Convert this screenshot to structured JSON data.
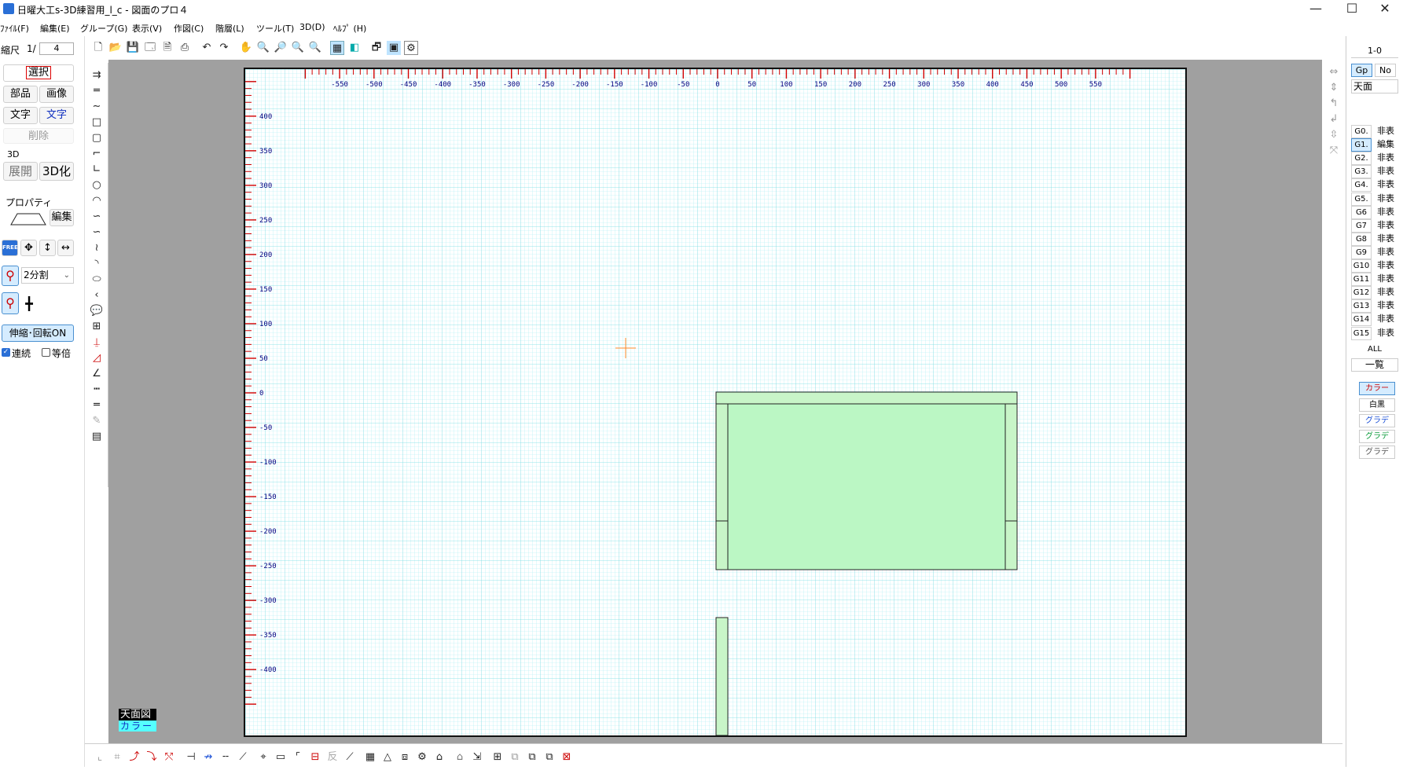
{
  "window": {
    "title": "日曜大工s-3D練習用_l_c - 図面のプロ４",
    "minimize": "—",
    "maximize": "☐",
    "close": "✕"
  },
  "menu": [
    "ﾌｧｲﾙ(F)",
    "編集(E)",
    "グループ(G)",
    "表示(V)",
    "作図(C)",
    "階層(L)",
    "ツール(T)",
    "3D(D)",
    "ﾍﾙﾌﾟ (H)"
  ],
  "left": {
    "scale_label": "縮尺",
    "scale_prefix": "1/",
    "scale_value": "4",
    "select": "選択",
    "parts": "部品",
    "image": "画像",
    "text": "文字",
    "text2": "文字",
    "delete": "削除",
    "section_3d": "3D",
    "expand": "展開",
    "to3d": "3D化",
    "property": "プロパティ",
    "edit": "編集",
    "free": "FREE",
    "split_value": "2分割",
    "scale_rotate": "伸縮･回転ON",
    "continuous": "連続",
    "equal": "等倍"
  },
  "canvas": {
    "x_ticks": [
      "-550",
      "-500",
      "-450",
      "-400",
      "-350",
      "-300",
      "-250",
      "-200",
      "-150",
      "-100",
      "-50",
      "0",
      "50",
      "100",
      "150",
      "200",
      "250",
      "300",
      "350",
      "400",
      "450",
      "500",
      "550"
    ],
    "y_ticks": [
      "400",
      "350",
      "300",
      "250",
      "200",
      "150",
      "100",
      "50",
      "0",
      "-50",
      "-100",
      "-150",
      "-200",
      "-250",
      "-300",
      "-350",
      "-400"
    ],
    "view_name": "天面図",
    "view_mode": "カラー"
  },
  "right": {
    "layer_id": "1-0",
    "gp": "Gp",
    "no": "No",
    "view": "天面",
    "groups": [
      {
        "g": "G0.",
        "s": "非表"
      },
      {
        "g": "G1.",
        "s": "編集"
      },
      {
        "g": "G2.",
        "s": "非表"
      },
      {
        "g": "G3.",
        "s": "非表"
      },
      {
        "g": "G4.",
        "s": "非表"
      },
      {
        "g": "G5.",
        "s": "非表"
      },
      {
        "g": "G6",
        "s": "非表"
      },
      {
        "g": "G7",
        "s": "非表"
      },
      {
        "g": "G8",
        "s": "非表"
      },
      {
        "g": "G9",
        "s": "非表"
      },
      {
        "g": "G10",
        "s": "非表"
      },
      {
        "g": "G11",
        "s": "非表"
      },
      {
        "g": "G12",
        "s": "非表"
      },
      {
        "g": "G13",
        "s": "非表"
      },
      {
        "g": "G14",
        "s": "非表"
      },
      {
        "g": "G15",
        "s": "非表"
      }
    ],
    "all": "ALL",
    "list": "一覧",
    "color": "カラー",
    "mono": "白黒",
    "grad1": "グラデ",
    "grad2": "グラデ",
    "grad3": "グラデ"
  },
  "colors": {
    "grid": "#9ee8ee",
    "ruler_red": "#d00000",
    "ruler_text": "#000080",
    "part_fill": "#bbf7c4",
    "part_top_fill": "#c8f5c8"
  }
}
